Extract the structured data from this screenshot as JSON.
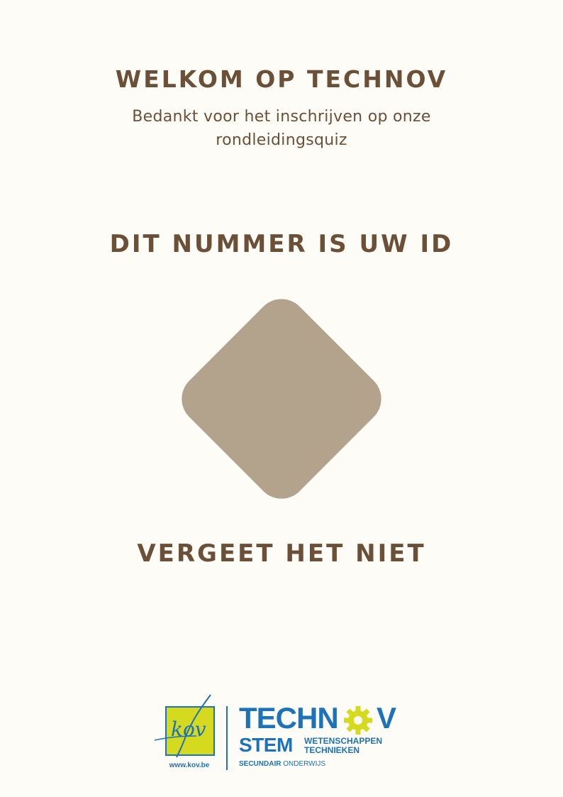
{
  "header": {
    "title": "WELKOM OP TECHNOV",
    "subtitle_line1": "Bedankt voor het inschrijven op onze",
    "subtitle_line2": "rondleidingsquiz"
  },
  "id_section": {
    "heading": "DIT NUMMER IS UW ID",
    "id_value": "",
    "reminder": "VERGEET HET NIET"
  },
  "footer": {
    "kov_logo_text": "kov",
    "kov_url": "www.kov.be",
    "technov_logo": {
      "word_part": "TECHN",
      "gear_letter_icon": "gear-icon",
      "last_letter": "V",
      "stem": "STEM",
      "stem_line1": "WETENSCHAPPEN",
      "stem_line2": "TECHNIEKEN",
      "school_bold": "SECUNDAIR",
      "school_rest": " ONDERWIJS"
    }
  },
  "colors": {
    "background": "#fdfcf7",
    "text_brown": "#6b4f37",
    "diamond": "#b3a38c",
    "brand_blue": "#1d72b8",
    "brand_yellow": "#d6da1f"
  }
}
